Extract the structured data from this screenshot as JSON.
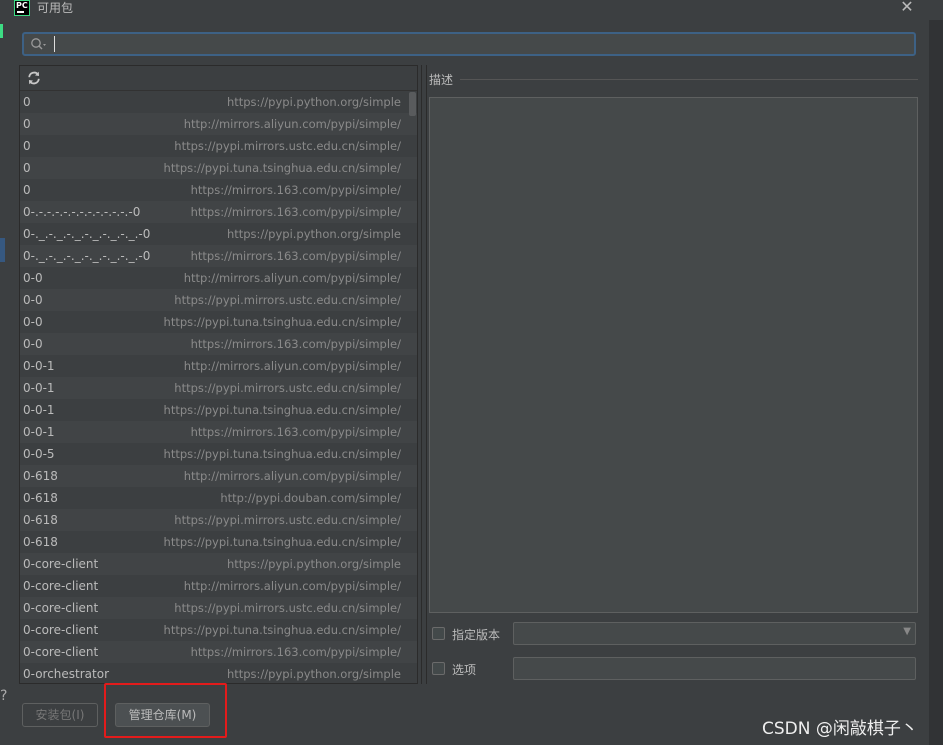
{
  "window": {
    "title": "可用包",
    "app_icon_text": "PC",
    "close_glyph": "✕"
  },
  "search": {
    "value": "",
    "placeholder": ""
  },
  "packages": [
    {
      "name": "0",
      "repo": "https://pypi.python.org/simple"
    },
    {
      "name": "0",
      "repo": "http://mirrors.aliyun.com/pypi/simple/"
    },
    {
      "name": "0",
      "repo": "https://pypi.mirrors.ustc.edu.cn/simple/"
    },
    {
      "name": "0",
      "repo": "https://pypi.tuna.tsinghua.edu.cn/simple/"
    },
    {
      "name": "0",
      "repo": "https://mirrors.163.com/pypi/simple/"
    },
    {
      "name": "0-.-.-.-.-.-.-.-.-.-.-.-.-0",
      "repo": "https://mirrors.163.com/pypi/simple/"
    },
    {
      "name": "0-._.-._.-._.-._.-._.-._.-0",
      "repo": "https://pypi.python.org/simple"
    },
    {
      "name": "0-._.-._.-._.-._.-._.-._.-0",
      "repo": "https://mirrors.163.com/pypi/simple/"
    },
    {
      "name": "0-0",
      "repo": "http://mirrors.aliyun.com/pypi/simple/"
    },
    {
      "name": "0-0",
      "repo": "https://pypi.mirrors.ustc.edu.cn/simple/"
    },
    {
      "name": "0-0",
      "repo": "https://pypi.tuna.tsinghua.edu.cn/simple/"
    },
    {
      "name": "0-0",
      "repo": "https://mirrors.163.com/pypi/simple/"
    },
    {
      "name": "0-0-1",
      "repo": "http://mirrors.aliyun.com/pypi/simple/"
    },
    {
      "name": "0-0-1",
      "repo": "https://pypi.mirrors.ustc.edu.cn/simple/"
    },
    {
      "name": "0-0-1",
      "repo": "https://pypi.tuna.tsinghua.edu.cn/simple/"
    },
    {
      "name": "0-0-1",
      "repo": "https://mirrors.163.com/pypi/simple/"
    },
    {
      "name": "0-0-5",
      "repo": "https://pypi.tuna.tsinghua.edu.cn/simple/"
    },
    {
      "name": "0-618",
      "repo": "http://mirrors.aliyun.com/pypi/simple/"
    },
    {
      "name": "0-618",
      "repo": "http://pypi.douban.com/simple/"
    },
    {
      "name": "0-618",
      "repo": "https://pypi.mirrors.ustc.edu.cn/simple/"
    },
    {
      "name": "0-618",
      "repo": "https://pypi.tuna.tsinghua.edu.cn/simple/"
    },
    {
      "name": "0-core-client",
      "repo": "https://pypi.python.org/simple"
    },
    {
      "name": "0-core-client",
      "repo": "http://mirrors.aliyun.com/pypi/simple/"
    },
    {
      "name": "0-core-client",
      "repo": "https://pypi.mirrors.ustc.edu.cn/simple/"
    },
    {
      "name": "0-core-client",
      "repo": "https://pypi.tuna.tsinghua.edu.cn/simple/"
    },
    {
      "name": "0-core-client",
      "repo": "https://mirrors.163.com/pypi/simple/"
    },
    {
      "name": "0-orchestrator",
      "repo": "https://pypi.python.org/simple"
    }
  ],
  "details": {
    "description_label": "描述",
    "specify_version_label": "指定版本",
    "specify_version_checked": false,
    "version_value": "",
    "options_label": "选项",
    "options_checked": false,
    "options_value": ""
  },
  "footer": {
    "install_label": "安装包(I)",
    "manage_repos_label": "管理仓库(M)"
  },
  "watermark": "CSDN @闲敲棋子丶",
  "colors": {
    "background": "#3c3f41",
    "focus_border": "#3d6185",
    "highlight_annotation": "#e31b1b"
  },
  "icons": {
    "search": "search-icon",
    "refresh": "refresh-icon",
    "close": "close-icon",
    "dropdown": "chevron-down-icon"
  }
}
